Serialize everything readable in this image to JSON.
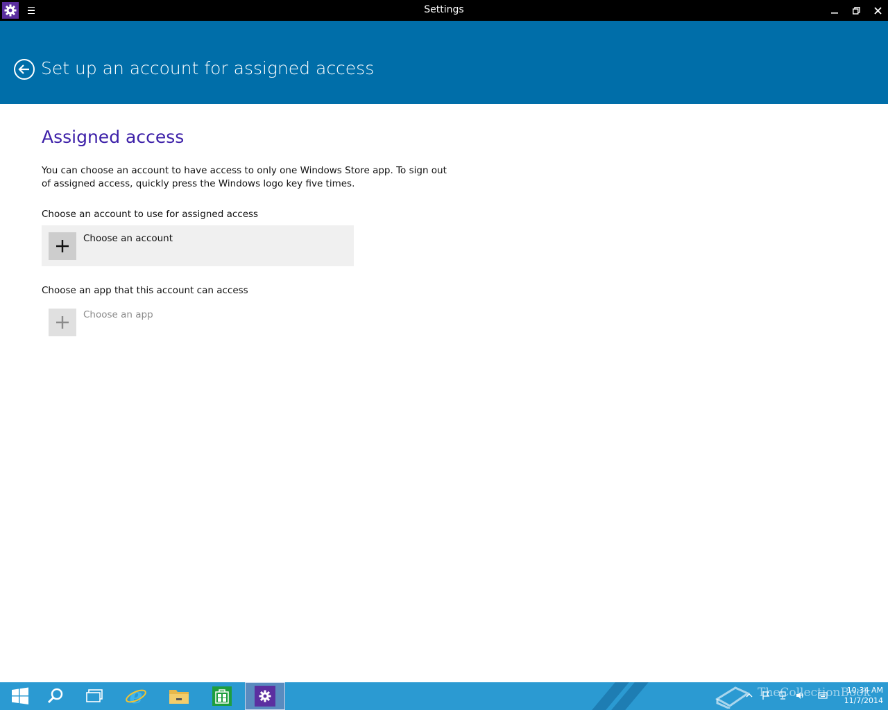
{
  "window": {
    "title": "Settings"
  },
  "header": {
    "title": "Set up an account for assigned access"
  },
  "content": {
    "section_title": "Assigned access",
    "description": "You can choose an account to have access to only one Windows Store app. To sign out of assigned access, quickly press the Windows logo key five times.",
    "account_label": "Choose an account to use for assigned access",
    "account_button": "Choose an account",
    "app_label": "Choose an app that this account can access",
    "app_button": "Choose an app"
  },
  "taskbar": {
    "watermark": "TheCollectionBook",
    "time": "10:34 AM",
    "date": "11/7/2014"
  },
  "colors": {
    "header_bg": "#006ea9",
    "section_title": "#3c1fa8",
    "taskbar_bg": "#2b9ad2",
    "app_icon_bg": "#5b2fa0"
  }
}
